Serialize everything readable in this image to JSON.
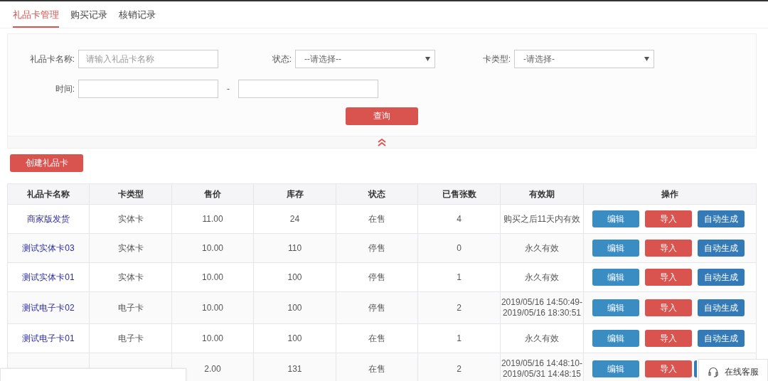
{
  "tabs": [
    {
      "label": "礼品卡管理",
      "selected": true
    },
    {
      "label": "购买记录",
      "selected": false
    },
    {
      "label": "核销记录",
      "selected": false
    }
  ],
  "filters": {
    "rows": [
      [
        {
          "kind": "text",
          "label": "礼品卡名称:",
          "placeholder": "请输入礼品卡名称"
        },
        {
          "kind": "select",
          "label": "状态:",
          "value": "--请选择--"
        },
        {
          "kind": "select",
          "label": "卡类型:",
          "value": "-请选择-"
        }
      ],
      [
        {
          "kind": "range",
          "label": "时间:",
          "separator": "-"
        }
      ]
    ],
    "search_button": "查询"
  },
  "create_button": "创建礼品卡",
  "table": {
    "columns": [
      "礼品卡名称",
      "卡类型",
      "售价",
      "库存",
      "状态",
      "已售张数",
      "有效期",
      "操作"
    ],
    "rows": [
      {
        "name": "商家版发货",
        "type": "实体卡",
        "price": "11.00",
        "stock": "24",
        "status": "在售",
        "sold": "4",
        "validity": [
          "购买之后11天内有效"
        ],
        "actions": [
          {
            "kind": "edit",
            "label": "编辑"
          },
          {
            "kind": "import",
            "label": "导入"
          },
          {
            "kind": "generate",
            "label": "自动生成"
          }
        ]
      },
      {
        "name": "测试实体卡03",
        "type": "实体卡",
        "price": "10.00",
        "stock": "110",
        "status": "停售",
        "sold": "0",
        "validity": [
          "永久有效"
        ],
        "actions": [
          {
            "kind": "edit",
            "label": "编辑"
          },
          {
            "kind": "import",
            "label": "导入"
          },
          {
            "kind": "generate",
            "label": "自动生成"
          }
        ]
      },
      {
        "name": "测试实体卡01",
        "type": "实体卡",
        "price": "10.00",
        "stock": "100",
        "status": "停售",
        "sold": "1",
        "validity": [
          "永久有效"
        ],
        "actions": [
          {
            "kind": "edit",
            "label": "编辑"
          },
          {
            "kind": "import",
            "label": "导入"
          },
          {
            "kind": "generate",
            "label": "自动生成"
          }
        ]
      },
      {
        "name": "测试电子卡02",
        "type": "电子卡",
        "price": "10.00",
        "stock": "100",
        "status": "停售",
        "sold": "2",
        "validity": [
          "2019/05/16 14:50:49-",
          "2019/05/16 18:30:51"
        ],
        "actions": [
          {
            "kind": "edit",
            "label": "编辑"
          },
          {
            "kind": "import",
            "label": "导入"
          },
          {
            "kind": "generate",
            "label": "自动生成"
          }
        ]
      },
      {
        "name": "测试电子卡01",
        "type": "电子卡",
        "price": "10.00",
        "stock": "100",
        "status": "在售",
        "sold": "1",
        "validity": [
          "永久有效"
        ],
        "actions": [
          {
            "kind": "edit",
            "label": "编辑"
          },
          {
            "kind": "import",
            "label": "导入"
          },
          {
            "kind": "generate",
            "label": "自动生成"
          }
        ]
      },
      {
        "price": "2.00",
        "stock": "131",
        "status": "在售",
        "sold": "2",
        "validity": [
          "2019/05/16 14:48:10-",
          "2019/05/31 14:48:15"
        ],
        "actions": [
          {
            "kind": "edit",
            "label": "编辑"
          },
          {
            "kind": "import",
            "label": "导入"
          },
          {
            "kind": "generate"
          }
        ]
      }
    ]
  },
  "chat_widget": {
    "label": "在线客服"
  }
}
